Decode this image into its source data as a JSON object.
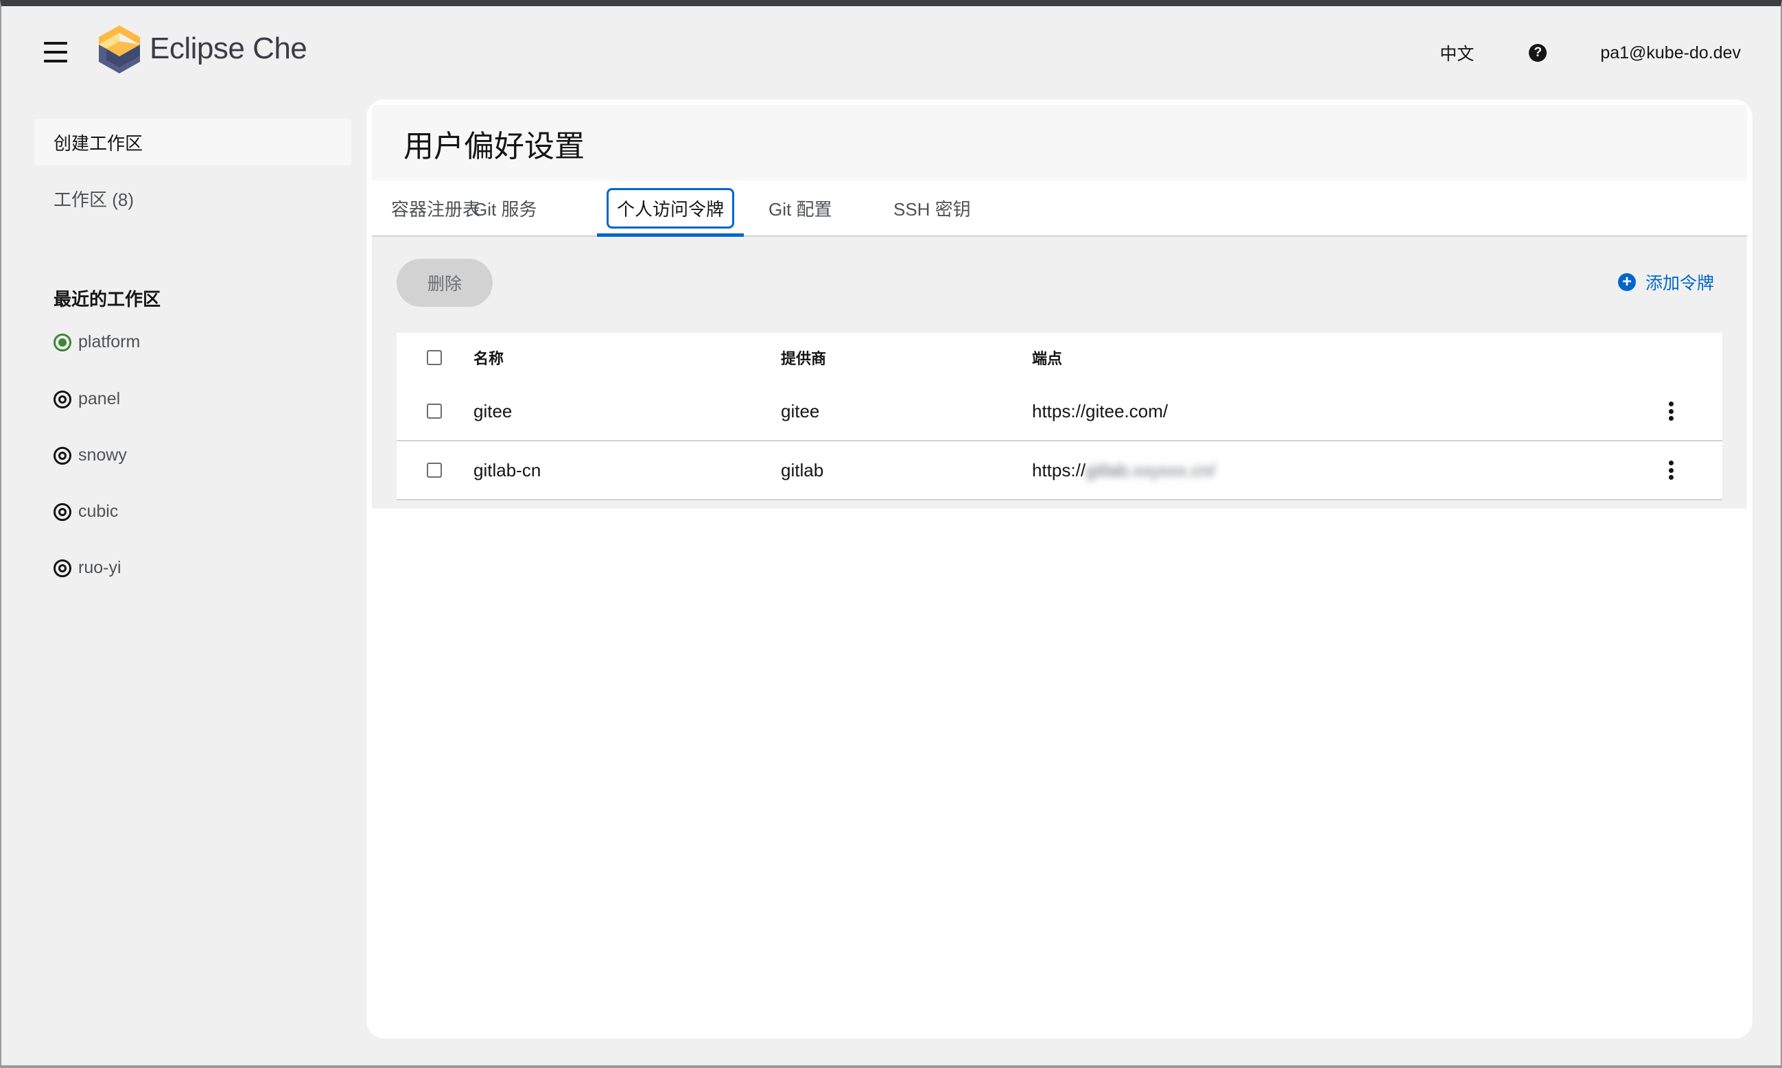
{
  "header": {
    "app_name": "Eclipse Che",
    "language": "中文",
    "help_icon": "?",
    "user": "pa1@kube-do.dev"
  },
  "sidebar": {
    "create_workspace": "创建工作区",
    "workspaces": "工作区 (8)",
    "recent_title": "最近的工作区",
    "recent": [
      {
        "name": "platform",
        "status": "running"
      },
      {
        "name": "panel",
        "status": "stopped"
      },
      {
        "name": "snowy",
        "status": "stopped"
      },
      {
        "name": "cubic",
        "status": "stopped"
      },
      {
        "name": "ruo-yi",
        "status": "stopped"
      }
    ]
  },
  "page": {
    "title": "用户偏好设置",
    "tabs": [
      {
        "label": "容器注册表"
      },
      {
        "label": "Git 服务"
      },
      {
        "label": "个人访问令牌",
        "active": true
      },
      {
        "label": "Git 配置"
      },
      {
        "label": "SSH 密钥"
      }
    ],
    "delete_label": "删除",
    "add_label": "添加令牌",
    "table": {
      "headers": {
        "name": "名称",
        "provider": "提供商",
        "endpoint": "端点"
      },
      "rows": [
        {
          "name": "gitee",
          "provider": "gitee",
          "endpoint": "https://gitee.com/"
        },
        {
          "name": "gitlab-cn",
          "provider": "gitlab",
          "endpoint_prefix": "https://",
          "endpoint_hidden": "gitlab.xxyxxx.cn/"
        }
      ]
    }
  },
  "colors": {
    "accent": "#0066cc",
    "running": "#3e8635",
    "logo_yellow": "#fdb940",
    "logo_navy": "#525c86"
  }
}
